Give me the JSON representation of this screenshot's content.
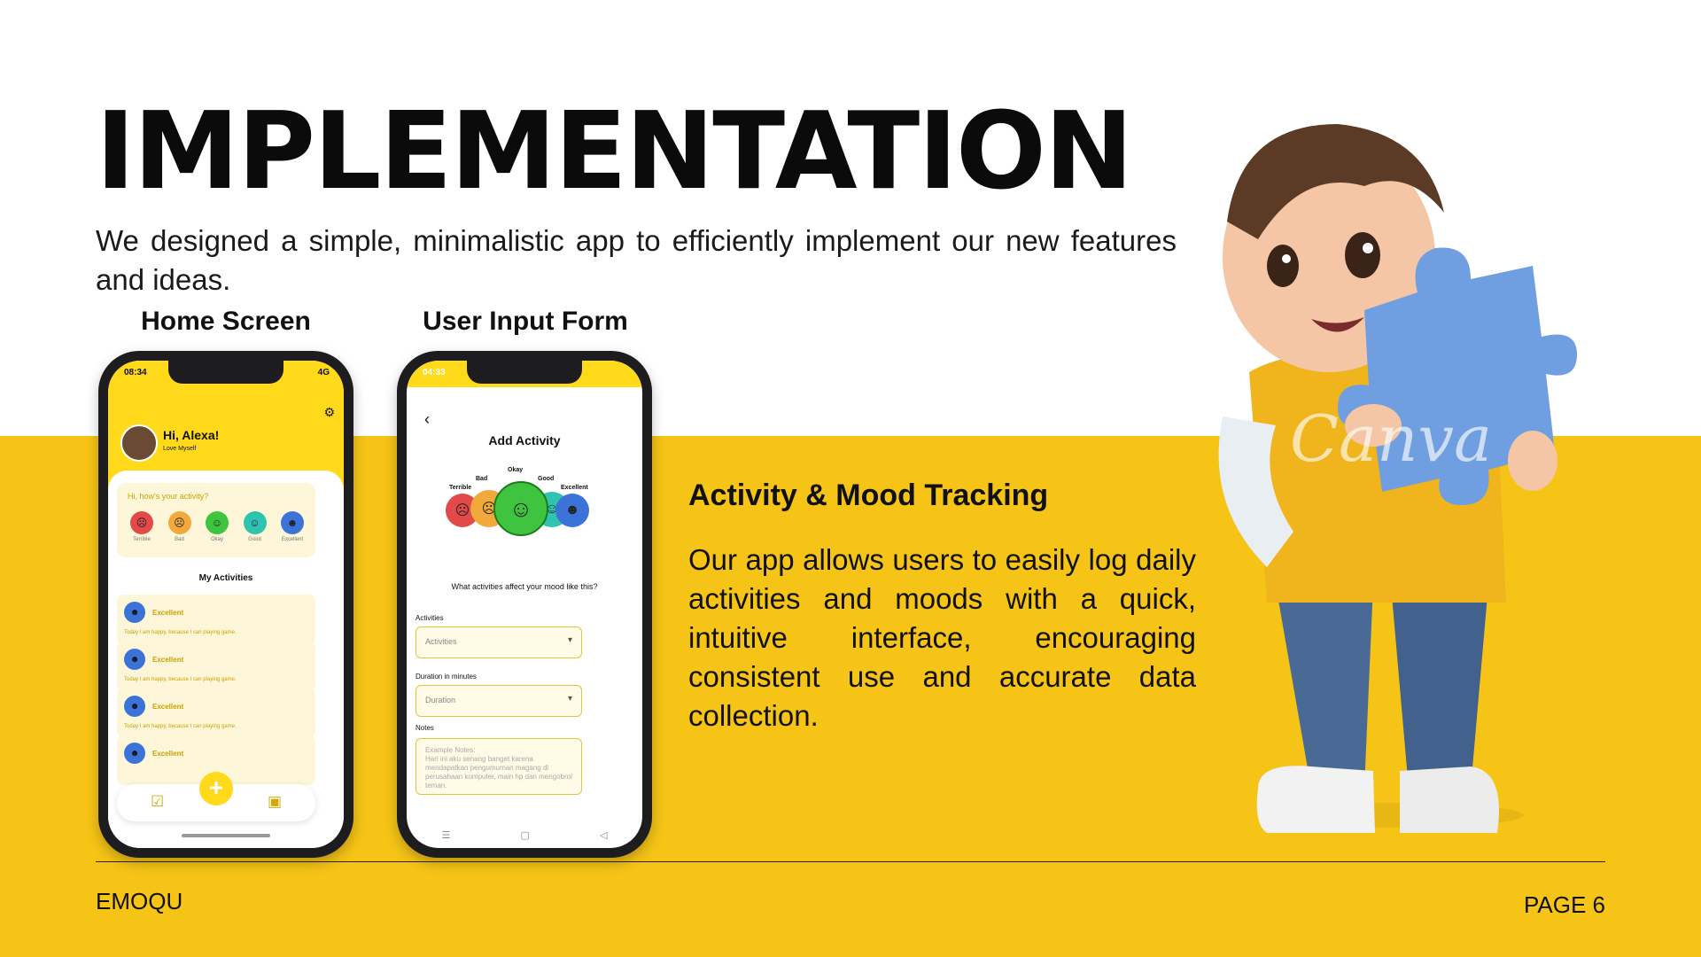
{
  "slide": {
    "title": "IMPLEMENTATION",
    "intro": "We designed a simple, minimalistic app to efficiently implement our new features and ideas.",
    "brand": "EMOQU",
    "page": "PAGE 6",
    "watermark": "Canva",
    "accent": "#f6c416"
  },
  "home_phone": {
    "label": "Home Screen",
    "time": "08:34",
    "signal": "4G",
    "greeting": "Hi, Alexa!",
    "subtitle": "Love Myself",
    "mood_question": "Hi, how's your activity?",
    "moods": [
      {
        "label": "Terrible",
        "color": "#e24a4a",
        "glyph": "☹"
      },
      {
        "label": "Bad",
        "color": "#f2a93b",
        "glyph": "☹"
      },
      {
        "label": "Okay",
        "color": "#3ec43e",
        "glyph": "☺"
      },
      {
        "label": "Good",
        "color": "#2ec4b0",
        "glyph": "☺"
      },
      {
        "label": "Excellent",
        "color": "#3b73d8",
        "glyph": "☻"
      }
    ],
    "activities_title": "My Activities",
    "activities": [
      {
        "level": "Excellent",
        "note": "Today I am happy, because I can playing game."
      },
      {
        "level": "Excellent",
        "note": "Today I am happy, because I can playing game."
      },
      {
        "level": "Excellent",
        "note": "Today I am happy, because I can playing game."
      },
      {
        "level": "Excellent",
        "note": ""
      }
    ]
  },
  "form_phone": {
    "label": "User Input Form",
    "time": "04:33",
    "title": "Add Activity",
    "mood_labels": [
      "Terrible",
      "Bad",
      "Okay",
      "Good",
      "Excellent"
    ],
    "question": "What activities affect your mood like this?",
    "activities_label": "Activities",
    "activities_value": "Activities",
    "duration_label": "Duration in minutes",
    "duration_value": "Duration",
    "notes_label": "Notes",
    "notes_placeholder": "Example Notes:\nHari ini aku senang banget karena mendapatkan pengumuman magang di perusahaan komputer, main hp dan mengobrol teman."
  },
  "feature": {
    "title": "Activity & Mood Tracking",
    "body": "Our app allows users to easily log daily activities and moods with a quick, intuitive interface, encouraging consistent use and accurate data collection."
  }
}
